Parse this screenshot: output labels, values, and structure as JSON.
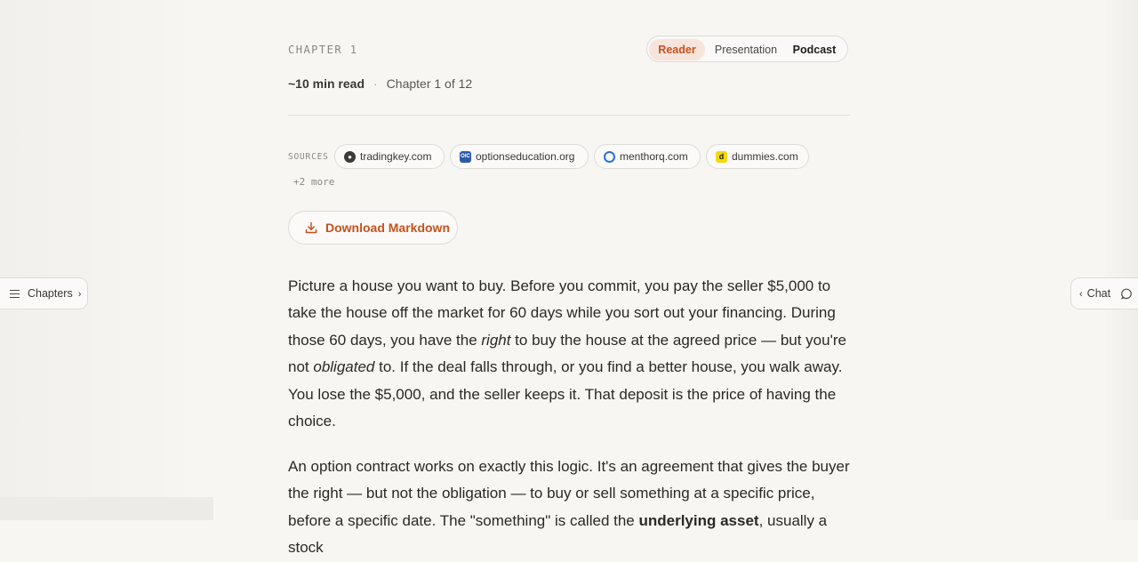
{
  "header": {
    "chapter_label": "CHAPTER 1",
    "read_time": "~10 min read",
    "separator": "·",
    "chapter_position": "Chapter 1 of 12"
  },
  "modes": {
    "reader": "Reader",
    "presentation": "Presentation",
    "podcast": "Podcast",
    "active": "Reader"
  },
  "sources": {
    "label": "SOURCES",
    "items": [
      {
        "domain": "tradingkey.com",
        "icon": "tradingkey-favicon"
      },
      {
        "domain": "optionseducation.org",
        "icon": "oic-favicon",
        "icon_text": "OIC"
      },
      {
        "domain": "menthorq.com",
        "icon": "menthorq-favicon"
      },
      {
        "domain": "dummies.com",
        "icon": "dummies-favicon",
        "icon_text": "d"
      }
    ],
    "more": "+2 more"
  },
  "download": {
    "label": "Download Markdown",
    "icon": "download-icon"
  },
  "side": {
    "chapters_label": "Chapters",
    "chat_label": "Chat"
  },
  "content": {
    "p1": {
      "s1": "Picture a house you want to buy. Before you commit, you pay the seller $5,000 to take the house off the market for 60 days while you sort out your financing. During those 60 days, you have the ",
      "em1": "right",
      "s2": " to buy the house at the agreed price — but you're not ",
      "em2": "obligated",
      "s3": " to. If the deal falls through, or you find a better house, you walk away. You lose the $5,000, and the seller keeps it. That deposit is the price of having the choice."
    },
    "p2": {
      "s1": "An option contract works on exactly this logic. It's an agreement that gives the buyer the right — but not the obligation — to buy or sell something at a specific price, before a specific date. The \"something\" is called the ",
      "strong1": "underlying asset",
      "s2": ", usually a stock"
    }
  },
  "colors": {
    "accent": "#c4521f",
    "accent_bg": "#f7e4da",
    "background": "#f7f6f3"
  }
}
